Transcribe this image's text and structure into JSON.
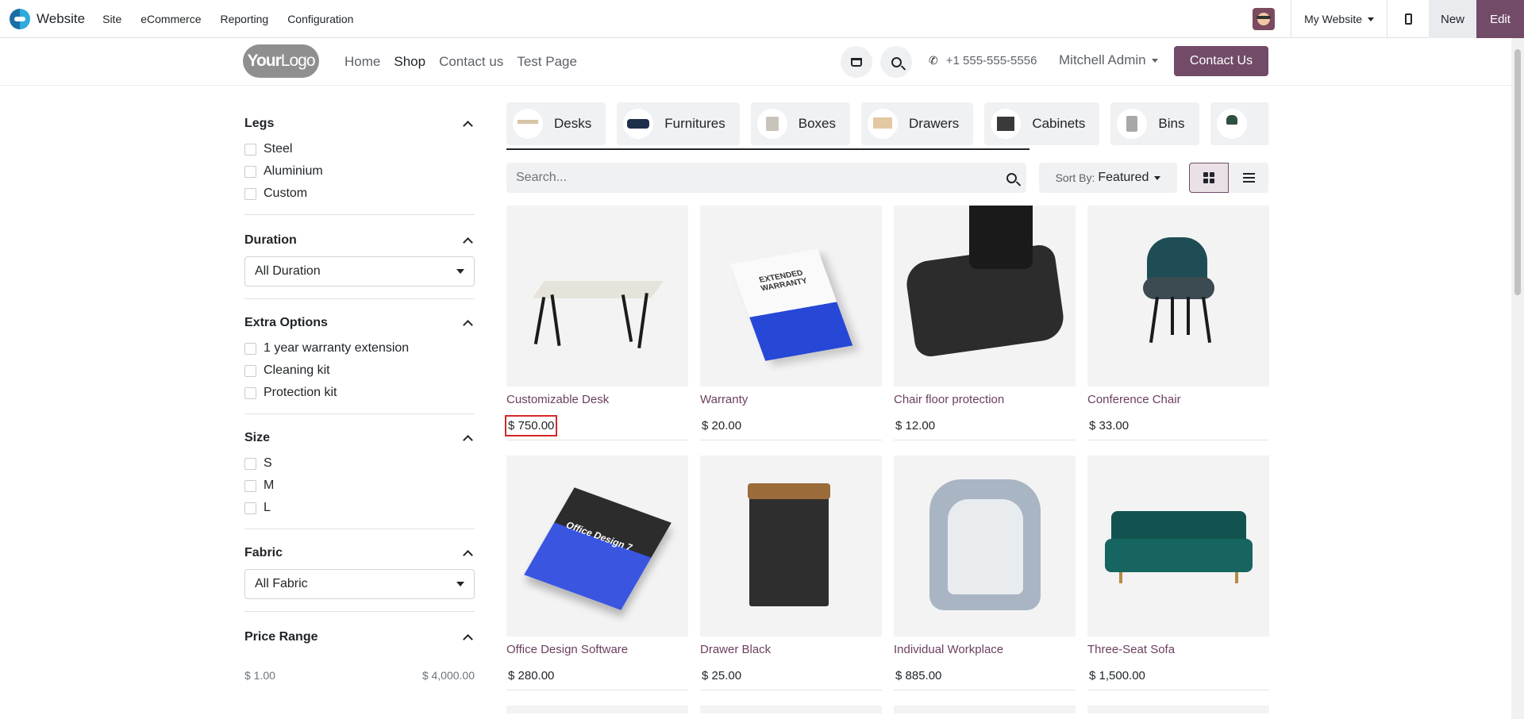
{
  "topbar": {
    "app_name": "Website",
    "menu": [
      "Site",
      "eCommerce",
      "Reporting",
      "Configuration"
    ],
    "website_selector": "My Website",
    "new_label": "New",
    "edit_label": "Edit"
  },
  "header": {
    "logo_text_bold": "Your",
    "logo_text_light": "Logo",
    "nav": [
      "Home",
      "Shop",
      "Contact us",
      "Test Page"
    ],
    "active_nav": "Shop",
    "phone": "+1 555-555-5556",
    "user": "Mitchell Admin",
    "contact_button": "Contact Us"
  },
  "filters": {
    "legs": {
      "title": "Legs",
      "options": [
        "Steel",
        "Aluminium",
        "Custom"
      ]
    },
    "duration": {
      "title": "Duration",
      "selected": "All Duration"
    },
    "extra": {
      "title": "Extra Options",
      "options": [
        "1 year warranty extension",
        "Cleaning kit",
        "Protection kit"
      ]
    },
    "size": {
      "title": "Size",
      "options": [
        "S",
        "M",
        "L"
      ]
    },
    "fabric": {
      "title": "Fabric",
      "selected": "All Fabric"
    },
    "price": {
      "title": "Price Range",
      "min": "$ 1.00",
      "max": "$ 4,000.00"
    }
  },
  "categories": [
    "Desks",
    "Furnitures",
    "Boxes",
    "Drawers",
    "Cabinets",
    "Bins"
  ],
  "search": {
    "placeholder": "Search..."
  },
  "sort": {
    "prefix": "Sort By:",
    "value": "Featured"
  },
  "products": [
    {
      "name": "Customizable Desk",
      "price": "$ 750.00"
    },
    {
      "name": "Warranty",
      "price": "$ 20.00",
      "box_text": "EXTENDED WARRANTY"
    },
    {
      "name": "Chair floor protection",
      "price": "$ 12.00"
    },
    {
      "name": "Conference Chair",
      "price": "$ 33.00"
    },
    {
      "name": "Office Design Software",
      "price": "$ 280.00",
      "box_text": "Office Design 7"
    },
    {
      "name": "Drawer Black",
      "price": "$ 25.00"
    },
    {
      "name": "Individual Workplace",
      "price": "$ 885.00"
    },
    {
      "name": "Three-Seat Sofa",
      "price": "$ 1,500.00"
    }
  ],
  "colors": {
    "brand": "#714b67",
    "product_name": "#6b3f5f",
    "highlight": "#d62728"
  }
}
